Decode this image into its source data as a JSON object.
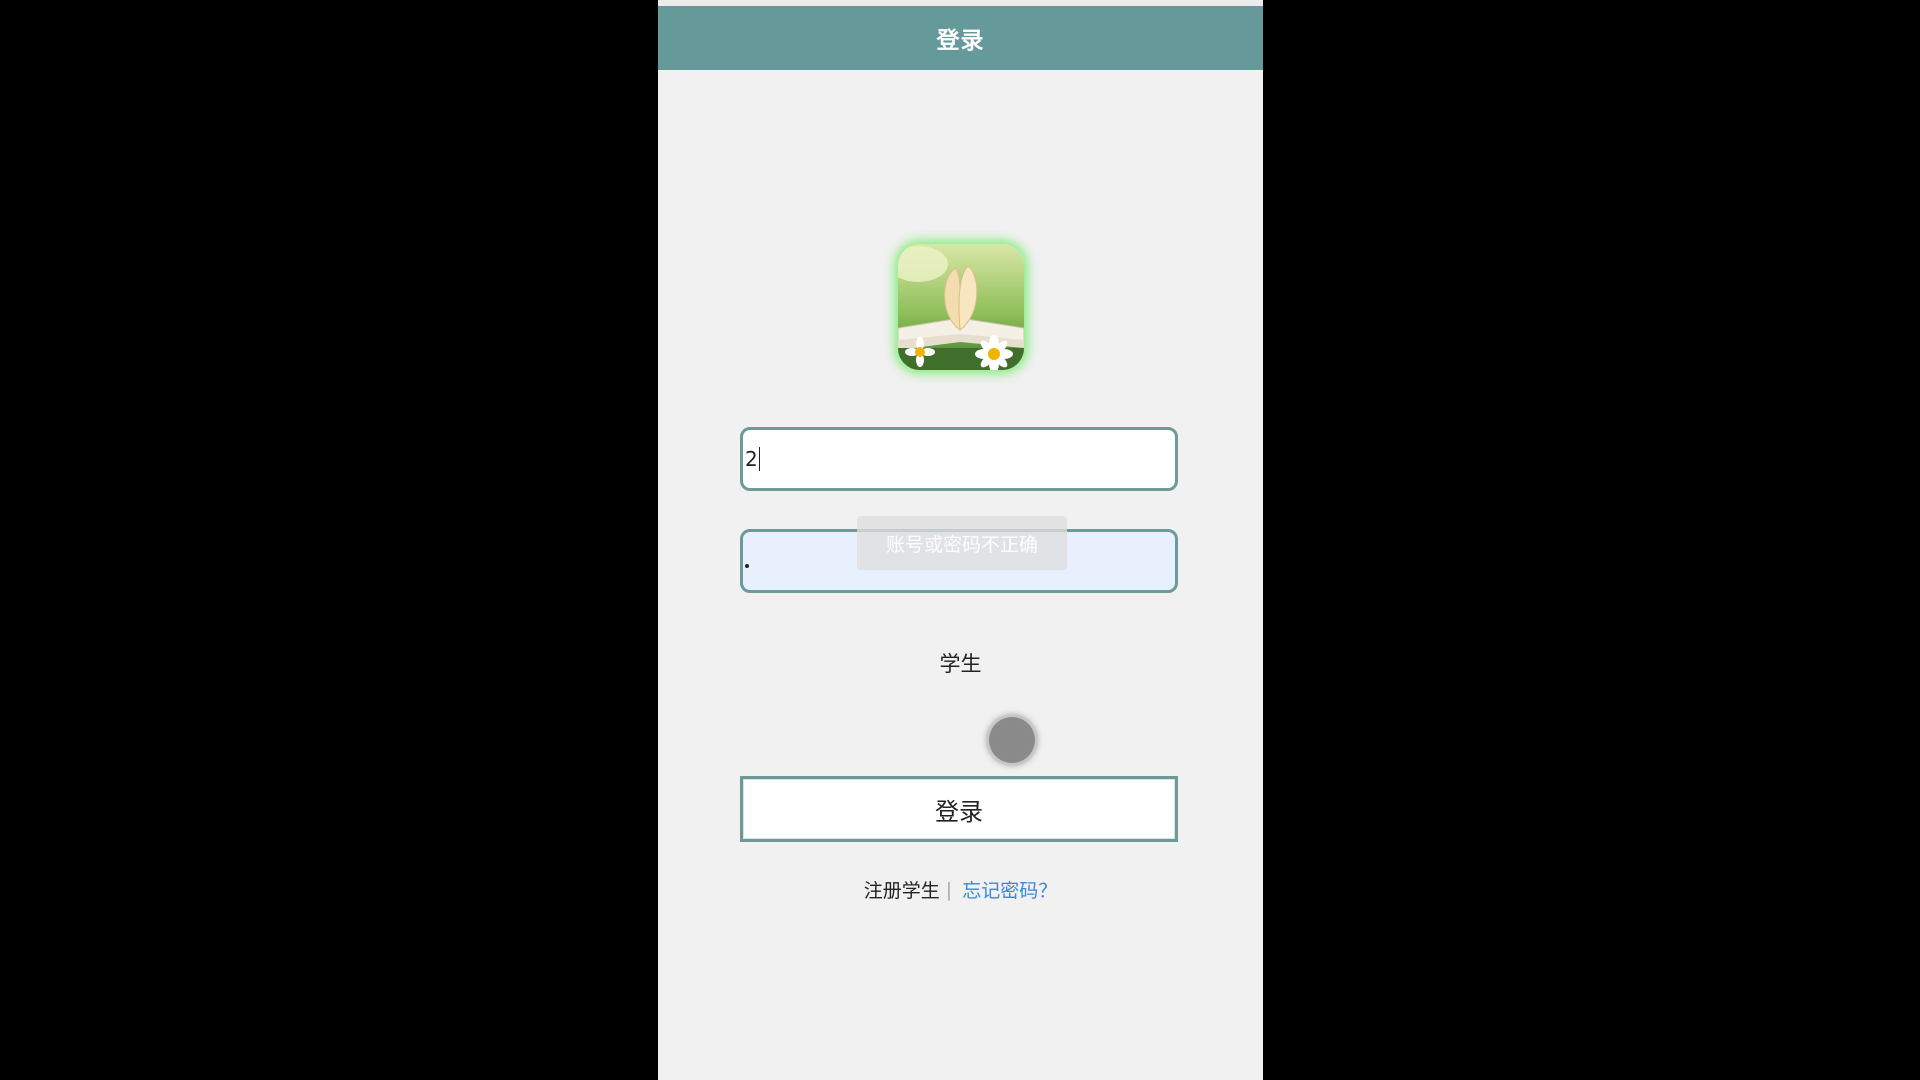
{
  "header": {
    "title": "登录"
  },
  "form": {
    "username_value": "2",
    "password_value": "•",
    "role_label": "学生",
    "login_button": "登录"
  },
  "toast": {
    "message": "账号或密码不正确"
  },
  "links": {
    "register": "注册学生",
    "separator": "|",
    "forgot": "忘记密码？"
  },
  "colors": {
    "header_bg": "#669999",
    "field_border": "#6b9a98",
    "link": "#3a86e0"
  },
  "icons": {
    "logo": "book-daisy-logo-icon",
    "touch_indicator": "touch-indicator-icon"
  }
}
